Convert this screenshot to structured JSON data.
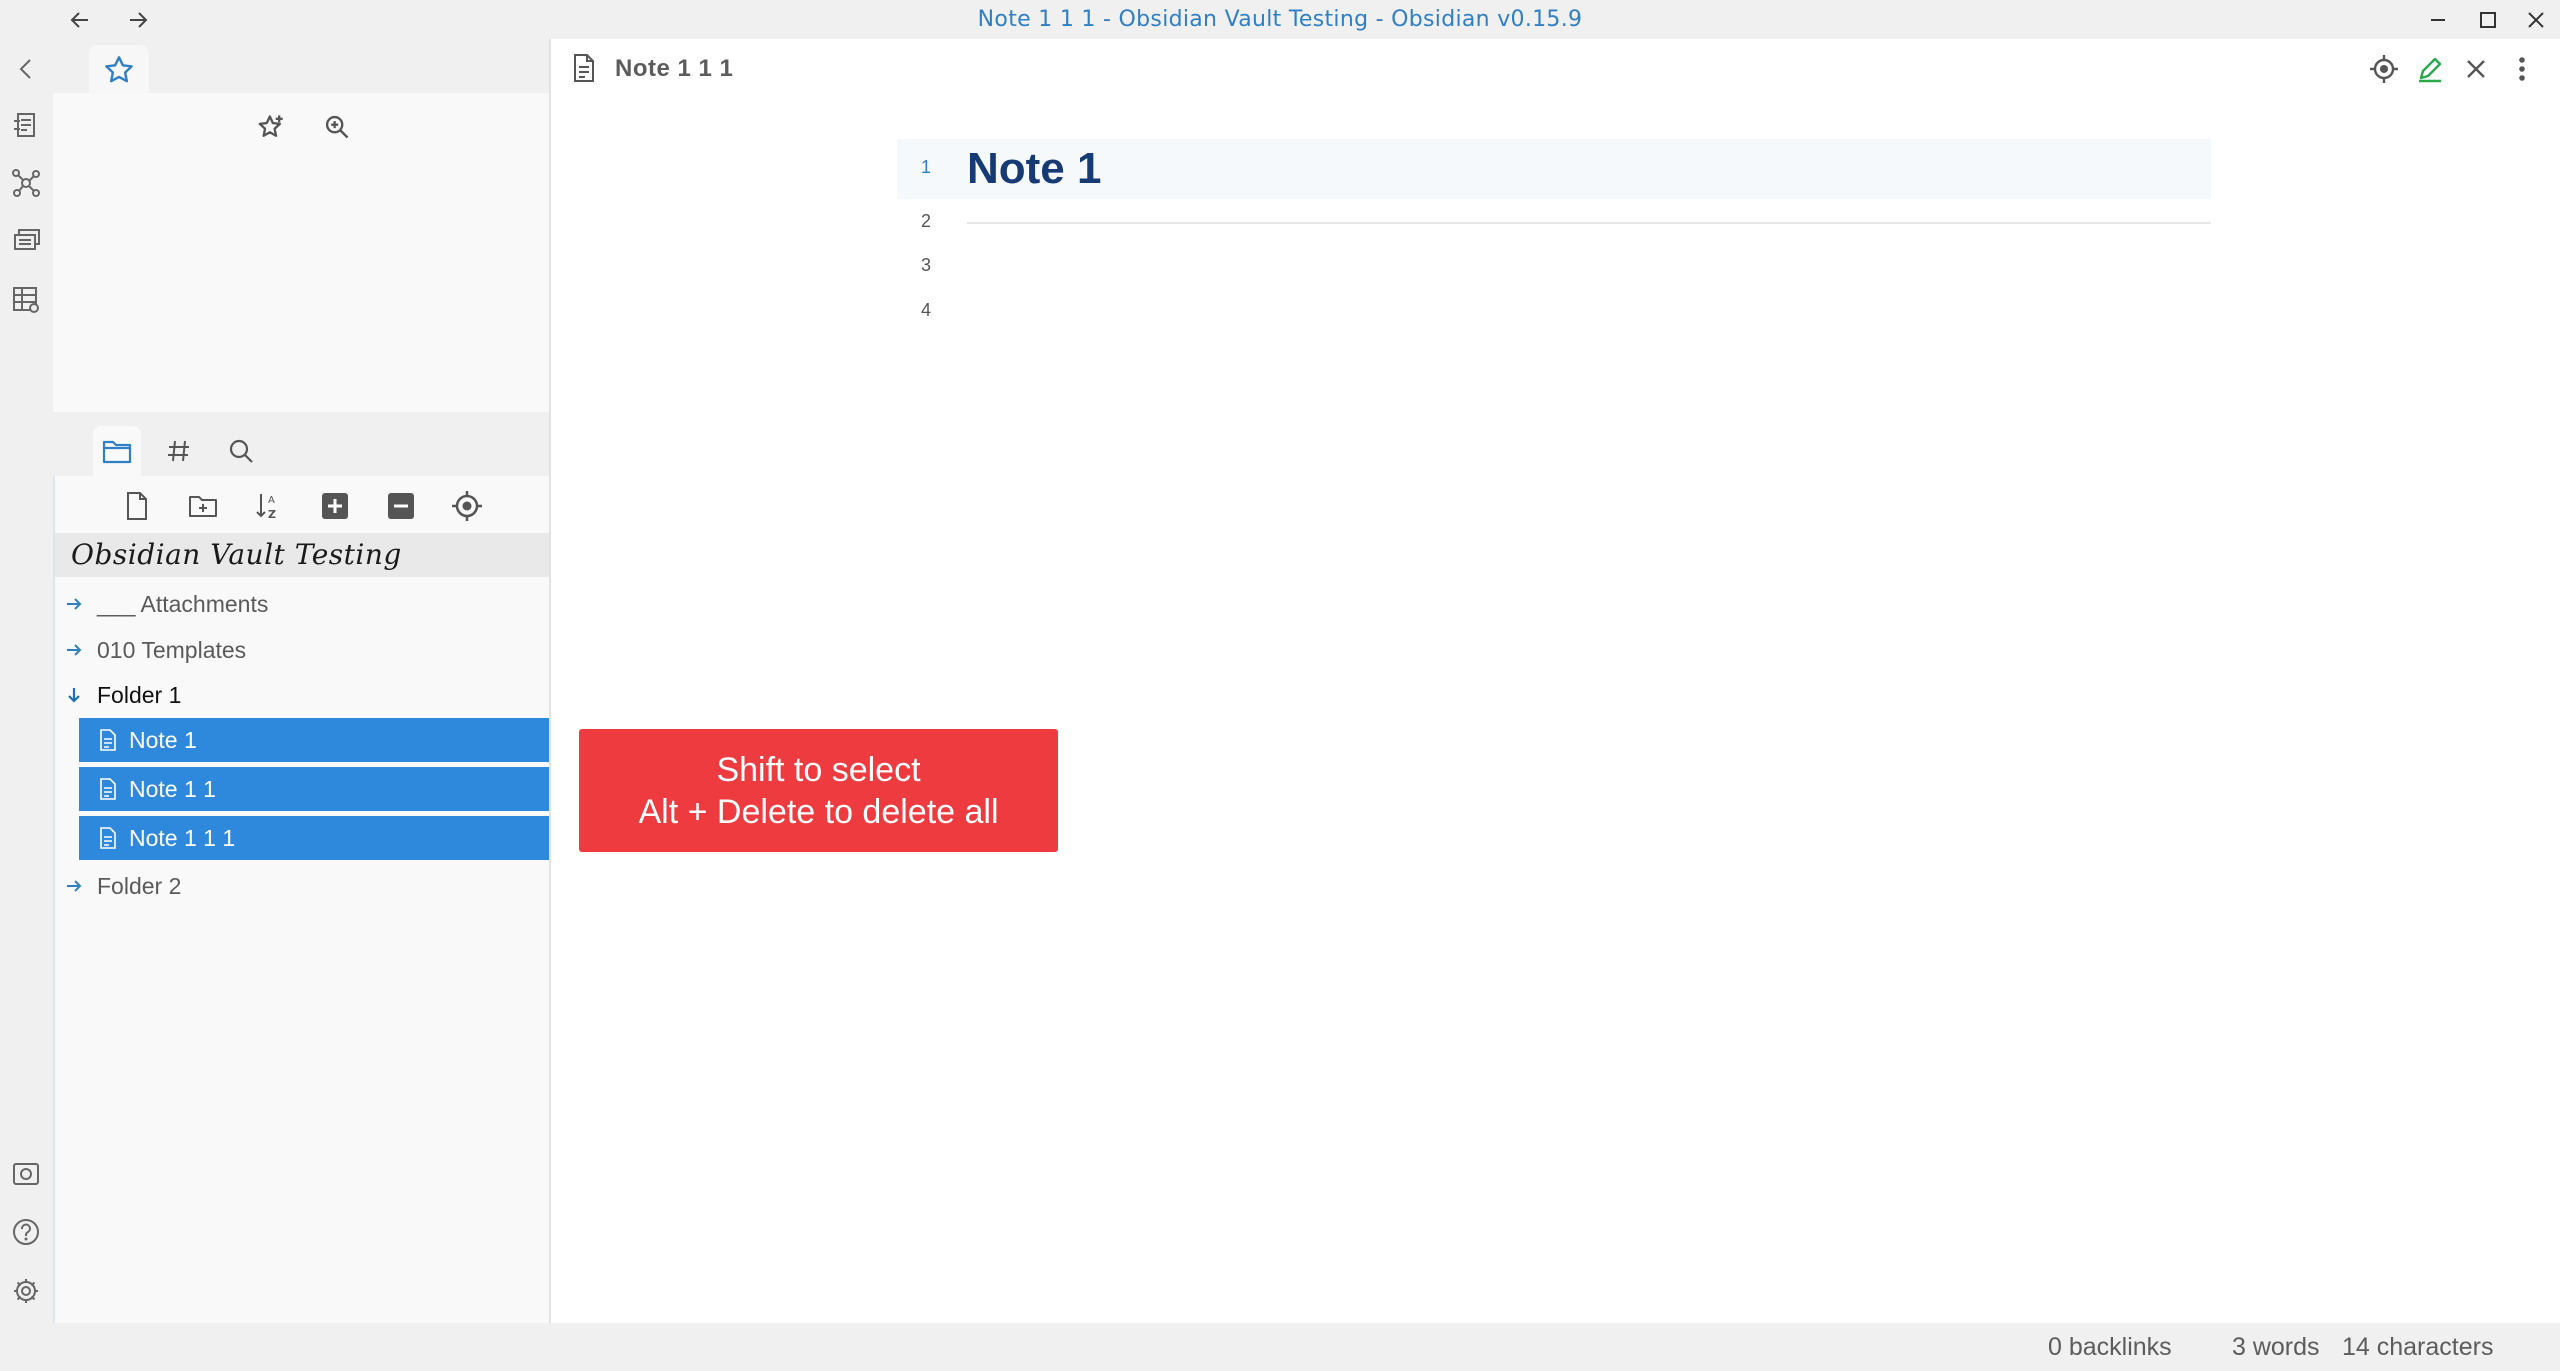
{
  "window": {
    "title": "Note 1 1 1 - Obsidian Vault Testing - Obsidian v0.15.9",
    "accent": "#2f7fc5"
  },
  "titlebar": {
    "back_icon": "arrow-left-icon",
    "forward_icon": "arrow-right-icon",
    "minimize_icon": "minimize-icon",
    "maximize_icon": "maximize-icon",
    "close_icon": "close-icon"
  },
  "ribbon": {
    "items": [
      "collapse-icon",
      "open-quick-switcher-icon",
      "graph-view-icon",
      "slides-icon",
      "table-icon"
    ],
    "bottom_items": [
      "vault-icon",
      "help-icon",
      "settings-icon"
    ]
  },
  "starred": {
    "tab_icon": "star-icon",
    "actions": [
      "star-add-icon",
      "zoom-icon"
    ]
  },
  "file_explorer": {
    "tabs": [
      "folder-icon",
      "hash-icon",
      "search-icon"
    ],
    "nav_actions": [
      "new-note-icon",
      "new-folder-icon",
      "sort-icon",
      "expand-all-icon",
      "collapse-all-icon",
      "reveal-active-file-icon"
    ],
    "vault_name": "Obsidian Vault Testing",
    "items": [
      {
        "label": "___ Attachments",
        "type": "folder",
        "open": false
      },
      {
        "label": "010 Templates",
        "type": "folder",
        "open": false
      },
      {
        "label": "Folder 1",
        "type": "folder",
        "open": true
      },
      {
        "label": "Folder 2",
        "type": "folder",
        "open": false
      }
    ],
    "files": [
      {
        "label": "Note 1",
        "selected": true
      },
      {
        "label": "Note 1 1",
        "selected": true
      },
      {
        "label": "Note 1 1 1",
        "selected": true
      }
    ],
    "selected_color": "#2e89dd"
  },
  "editor": {
    "file_title": "Note 1 1 1",
    "header_actions": [
      "locate-icon",
      "edit-icon",
      "close-icon",
      "more-icon"
    ],
    "lines": [
      "1",
      "2",
      "3",
      "4"
    ],
    "heading": "Note 1"
  },
  "overlay": {
    "line1": "Shift to select",
    "line2": "Alt + Delete to delete all",
    "color": "#ee3b3f"
  },
  "statusbar": {
    "backlinks": "0 backlinks",
    "words": "3 words",
    "characters": "14 characters"
  }
}
